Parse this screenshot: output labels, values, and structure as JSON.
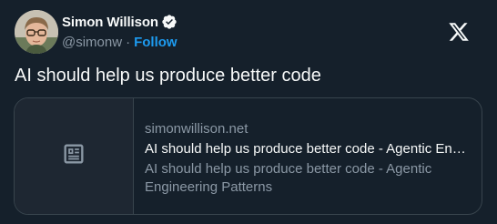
{
  "author": {
    "display_name": "Simon Willison",
    "handle": "@simonw",
    "separator": "·",
    "follow_label": "Follow",
    "verified": true
  },
  "tweet": {
    "text": "AI should help us produce better code"
  },
  "card": {
    "domain": "simonwillison.net",
    "title": "AI should help us produce better code - Agentic Engineering Patterns",
    "description": "AI should help us produce better code - Agentic Engineering Patterns",
    "thumbnail_icon": "article-icon"
  },
  "icons": {
    "logo": "x-logo-icon",
    "badge": "verified-badge-icon"
  },
  "colors": {
    "background": "#15202b",
    "accent": "#1d9bf0",
    "muted": "#8b98a5",
    "border": "#38444d"
  }
}
